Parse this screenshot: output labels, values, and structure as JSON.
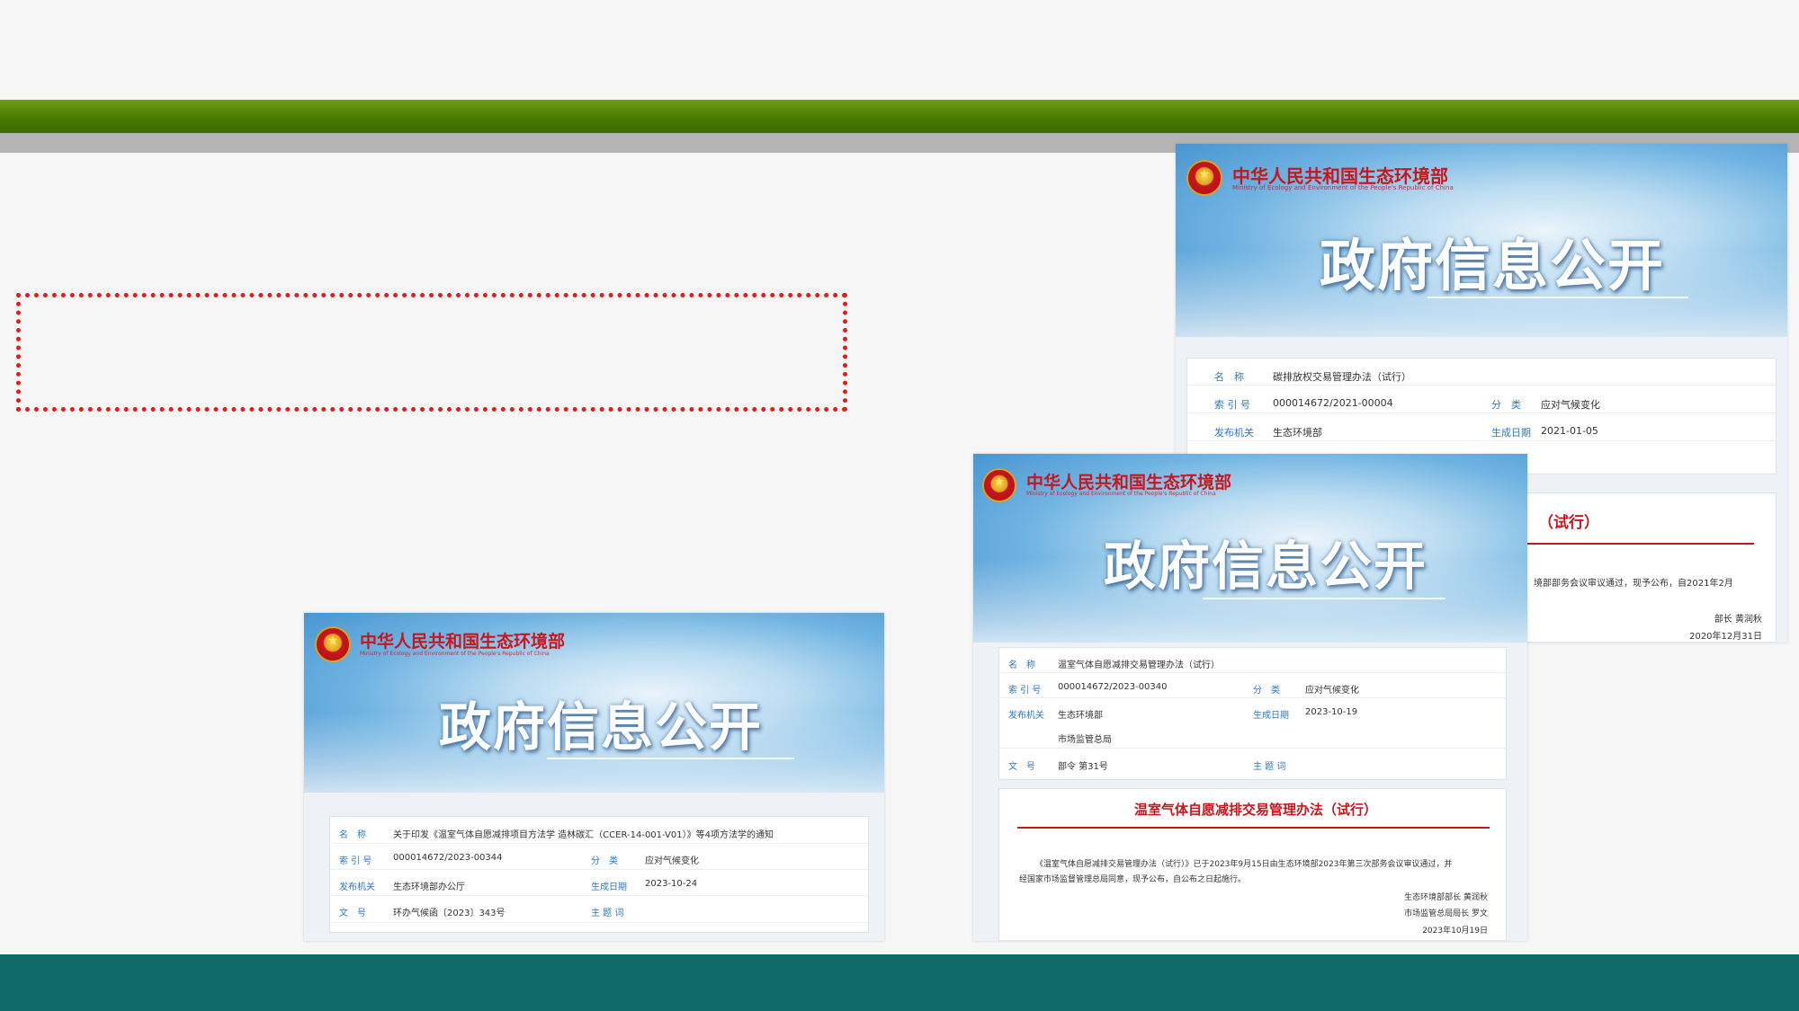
{
  "cards": {
    "back": {
      "ministry_cn": "中华人民共和国生态环境部",
      "ministry_en": "Ministry of Ecology and Environment of the People's Republic of China",
      "banner_title": "政府信息公开",
      "info": {
        "name_label": "名　称",
        "name_value": "碳排放权交易管理办法（试行）",
        "index_label": "索 引 号",
        "index_value": "000014672/2021-00004",
        "category_label": "分　类",
        "category_value": "应对气候变化",
        "issuer_label": "发布机关",
        "issuer_value": "生态环境部",
        "date_label": "生成日期",
        "date_value": "2021-01-05"
      },
      "doc": {
        "title_partial": "（试行）",
        "body_partial": "境部部务会议审议通过，现予公布，自2021年2月",
        "sign_1": "部长 黄润秋",
        "sign_2": "2020年12月31日"
      }
    },
    "middle": {
      "ministry_cn": "中华人民共和国生态环境部",
      "ministry_en": "Ministry of Ecology and Environment of the People's Republic of China",
      "banner_title": "政府信息公开",
      "info": {
        "name_label": "名　称",
        "name_value": "温室气体自愿减排交易管理办法（试行）",
        "index_label": "索 引 号",
        "index_value": "000014672/2023-00340",
        "category_label": "分　类",
        "category_value": "应对气候变化",
        "issuer_label": "发布机关",
        "issuer_value": "生态环境部",
        "issuer_value_2": "市场监管总局",
        "date_label": "生成日期",
        "date_value": "2023-10-19",
        "docno_label": "文　号",
        "docno_value": "部令 第31号",
        "keyword_label": "主 题 词"
      },
      "doc": {
        "title": "温室气体自愿减排交易管理办法（试行）",
        "body_1": "《温室气体自愿减排交易管理办法（试行）》已于2023年9月15日由生态环境部2023年第三次部务会议审议通过，并",
        "body_2": "经国家市场监督管理总局同意，现予公布，自公布之日起施行。",
        "sign_1": "生态环境部部长 黄润秋",
        "sign_2": "市场监管总局局长 罗文",
        "sign_3": "2023年10月19日"
      }
    },
    "front": {
      "ministry_cn": "中华人民共和国生态环境部",
      "ministry_en": "Ministry of Ecology and Environment of the People's Republic of China",
      "banner_title": "政府信息公开",
      "info": {
        "name_label": "名　称",
        "name_value": "关于印发《温室气体自愿减排项目方法学 造林碳汇（CCER-14-001-V01）》等4项方法学的通知",
        "index_label": "索 引 号",
        "index_value": "000014672/2023-00344",
        "category_label": "分　类",
        "category_value": "应对气候变化",
        "issuer_label": "发布机关",
        "issuer_value": "生态环境部办公厅",
        "date_label": "生成日期",
        "date_value": "2023-10-24",
        "docno_label": "文　号",
        "docno_value": "环办气候函〔2023〕343号",
        "keyword_label": "主 题 词"
      }
    }
  }
}
